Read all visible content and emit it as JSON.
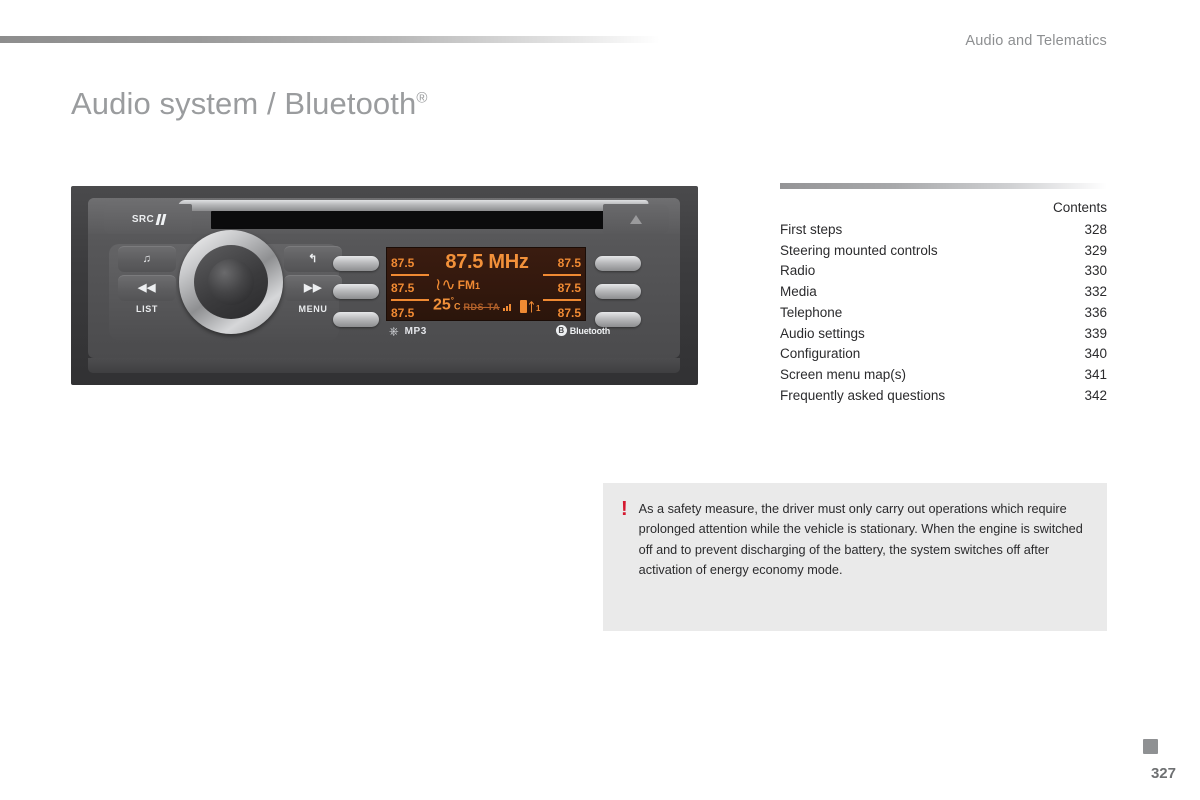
{
  "header": {
    "section": "Audio and Telematics"
  },
  "title": {
    "main": "Audio system / Bluetooth",
    "sup": "®"
  },
  "device": {
    "src_label": "SRC",
    "eject_icon": "eject-icon",
    "buttons": {
      "music_icon": "♫",
      "back_icon": "↰",
      "rewind_icon": "◀◀",
      "forward_icon": "▶▶",
      "list_label": "LIST",
      "menu_label": "MENU"
    },
    "display": {
      "frequency": "87.5 MHz",
      "band": "FM",
      "band_index": "1",
      "temperature": "25",
      "temp_unit": "C",
      "temp_degree": "°",
      "rds": "RDS-TA",
      "bt_device_number": "1",
      "presets_left": [
        "87.5",
        "87.5",
        "87.5"
      ],
      "presets_right": [
        "87.5",
        "87.5",
        "87.5"
      ]
    },
    "footer_labels": {
      "usb_icon": "usb-icon",
      "mp3": "MP3",
      "bluetooth_badge": "B",
      "bluetooth_word": "Bluetooth"
    }
  },
  "contents": {
    "heading": "Contents",
    "items": [
      {
        "label": "First steps",
        "page": "328"
      },
      {
        "label": "Steering mounted controls",
        "page": "329"
      },
      {
        "label": "Radio",
        "page": "330"
      },
      {
        "label": "Media",
        "page": "332"
      },
      {
        "label": "Telephone",
        "page": "336"
      },
      {
        "label": "Audio settings",
        "page": "339"
      },
      {
        "label": "Configuration",
        "page": "340"
      },
      {
        "label": "Screen menu map(s)",
        "page": "341"
      },
      {
        "label": "Frequently asked questions",
        "page": "342"
      }
    ]
  },
  "warning": {
    "marker": "!",
    "text": "As a safety measure, the driver must only carry out operations which require prolonged attention while the vehicle is stationary. When the engine is switched off and to prevent discharging of the battery, the system switches off after activation of energy economy mode."
  },
  "footer": {
    "page_number": "327"
  },
  "colors": {
    "title_gray": "#9a9c9e",
    "body_text": "#2b2b2d",
    "warning_red": "#d5182f",
    "warning_bg": "#eaeaea",
    "lcd_orange": "#f08a33",
    "lcd_bg": "#33180d"
  }
}
